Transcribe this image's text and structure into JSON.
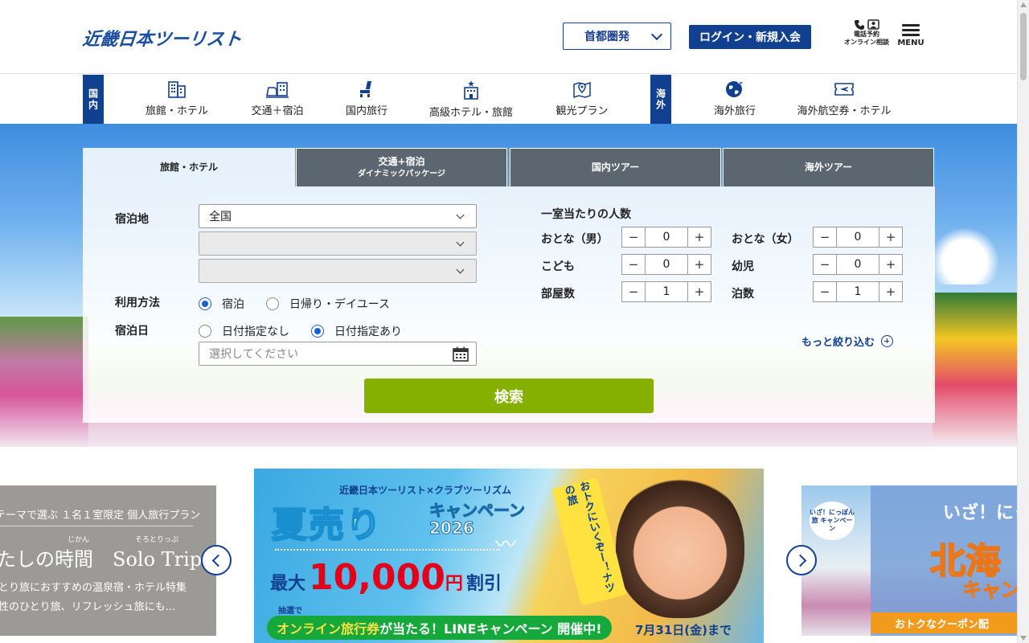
{
  "header": {
    "logo": "近畿日本ツーリスト",
    "region": "首都圏発",
    "login": "ログイン・新規入会",
    "tel_line1": "電話予約",
    "tel_line2": "オンライン相談",
    "menu": "MENU"
  },
  "nav": {
    "domestic_tag": "国内",
    "overseas_tag": "海外",
    "items": [
      {
        "label": "旅館・ホテル",
        "icon": "building-icon"
      },
      {
        "label": "交通＋宿泊",
        "icon": "train-hotel-icon"
      },
      {
        "label": "国内旅行",
        "icon": "seat-icon"
      },
      {
        "label": "高級ホテル・旅館",
        "icon": "luxury-hotel-icon"
      },
      {
        "label": "観光プラン",
        "icon": "map-pin-icon"
      },
      {
        "label": "海外旅行",
        "icon": "globe-plane-icon"
      },
      {
        "label": "海外航空券・ホテル",
        "icon": "ticket-plane-icon"
      }
    ]
  },
  "search": {
    "tabs": [
      {
        "label": "旅館・ホテル",
        "sub": ""
      },
      {
        "label": "交通+宿泊",
        "sub": "ダイナミックパッケージ"
      },
      {
        "label": "国内ツアー",
        "sub": ""
      },
      {
        "label": "海外ツアー",
        "sub": ""
      }
    ],
    "destination_label": "宿泊地",
    "destination_value": "全国",
    "usage_label": "利用方法",
    "usage_options": [
      "宿泊",
      "日帰り・デイユース"
    ],
    "usage_selected": "宿泊",
    "date_label": "宿泊日",
    "date_options": [
      "日付指定なし",
      "日付指定あり"
    ],
    "date_selected": "日付指定あり",
    "date_placeholder": "選択してください",
    "submit": "検索",
    "guests_title": "一室当たりの人数",
    "guests": [
      {
        "label": "おとな（男）",
        "value": "0"
      },
      {
        "label": "おとな（女）",
        "value": "0"
      },
      {
        "label": "こども",
        "value": "0"
      },
      {
        "label": "幼児",
        "value": "0"
      },
      {
        "label": "部屋数",
        "value": "1"
      },
      {
        "label": "泊数",
        "value": "1"
      }
    ],
    "minus": "−",
    "plus": "+",
    "more": "もっと絞り込む"
  },
  "carousel": {
    "left": {
      "line1": "テーマで選ぶ １名１室限定 個人旅行プラン",
      "ruby1": "じかん",
      "ruby2": "そろとりっぷ",
      "line2": "たしの時間　Solo Trip",
      "line3": "とり旅におすすめの温泉宿・ホテル特集",
      "line4": "性のひとり旅、リフレッシュ旅にも…"
    },
    "main": {
      "brand": "近畿日本ツーリスト×クラブツーリズム",
      "title": "夏売り",
      "campaign": "キャンペーン",
      "year": "2026",
      "max_pre": "最大",
      "max_value": "10,000",
      "max_yen": "円",
      "max_post": "割引",
      "lottery": "抽選で",
      "line_hl": "オンライン旅行券",
      "line_rest": "が当たる！LINEキャンペーン 開催中!",
      "date": "7月31日(金)まで",
      "tag": "おトクにいくぞー！ナツの旅"
    },
    "right": {
      "badge": "いざ！にっぽん旅 キャンペーン",
      "iza": "いざ！にっ",
      "title": "北海",
      "campaign": "キャン",
      "coupon": "おトクなクーポン配"
    }
  },
  "colors": {
    "brand_blue": "#10408f",
    "search_green": "#86b000",
    "tab_gray": "#5c6670"
  }
}
